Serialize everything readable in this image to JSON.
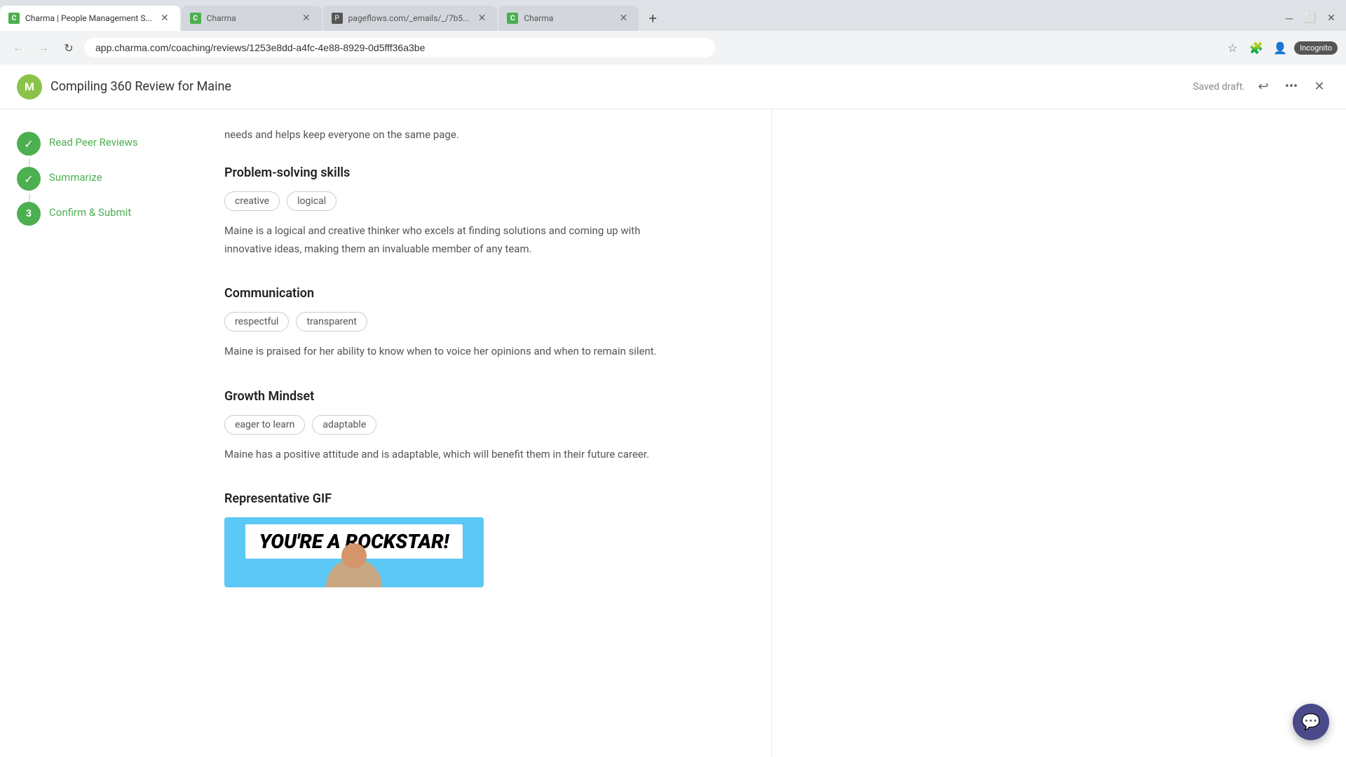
{
  "browser": {
    "tabs": [
      {
        "id": "tab1",
        "label": "Charma | People Management S...",
        "favicon": "charma-green",
        "active": true,
        "closable": true
      },
      {
        "id": "tab2",
        "label": "Charma",
        "favicon": "charma-green",
        "active": false,
        "closable": true
      },
      {
        "id": "tab3",
        "label": "pageflows.com/_emails/_/7b5...",
        "favicon": "pageflows",
        "active": false,
        "closable": true
      },
      {
        "id": "tab4",
        "label": "Charma",
        "favicon": "charma-green",
        "active": false,
        "closable": true
      }
    ],
    "url": "app.charma.com/coaching/reviews/1253e8dd-a4fc-4e88-8929-0d5fff36a3be",
    "incognito_label": "Incognito"
  },
  "header": {
    "logo_letter": "M",
    "title": "Compiling 360 Review for Maine",
    "saved_draft": "Saved draft.",
    "history_icon": "↩",
    "more_icon": "•••",
    "close_icon": "✕"
  },
  "sidebar": {
    "steps": [
      {
        "id": "step1",
        "number": "✓",
        "label": "Read Peer Reviews",
        "state": "completed"
      },
      {
        "id": "step2",
        "number": "✓",
        "label": "Summarize",
        "state": "completed"
      },
      {
        "id": "step3",
        "number": "3",
        "label": "Confirm & Submit",
        "state": "active"
      }
    ]
  },
  "main": {
    "top_text": "needs and helps keep everyone on the same page.",
    "sections": [
      {
        "id": "problem-solving",
        "title": "Problem-solving skills",
        "tags": [
          "creative",
          "logical"
        ],
        "text": "Maine is a logical and creative thinker who excels at finding solutions and coming up with innovative ideas, making them an invaluable member of any team."
      },
      {
        "id": "communication",
        "title": "Communication",
        "tags": [
          "respectful",
          "transparent"
        ],
        "text": "Maine is praised for her ability to know when to voice her opinions and when to remain silent."
      },
      {
        "id": "growth-mindset",
        "title": "Growth Mindset",
        "tags": [
          "eager to learn",
          "adaptable"
        ],
        "text": "Maine has a positive attitude and is adaptable, which will benefit them in their future career."
      }
    ],
    "gif_section": {
      "title": "Representative GIF",
      "text": "YOU'RE A ROCKSTAR!"
    }
  },
  "chat_widget": {
    "icon": "💬"
  }
}
